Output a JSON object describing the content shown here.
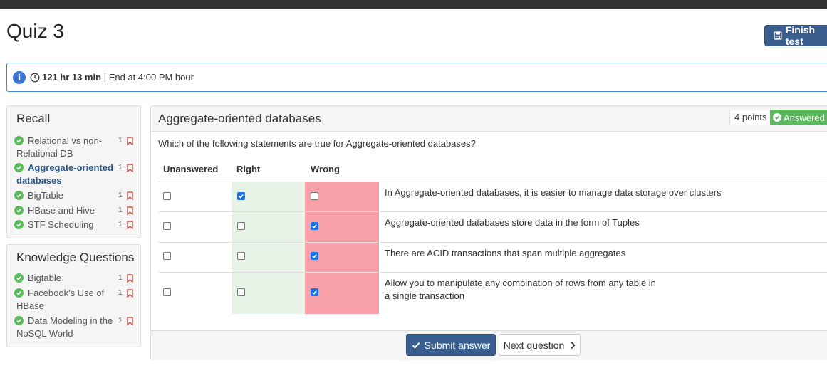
{
  "page": {
    "title": "Quiz 3"
  },
  "header": {
    "finish_label": "Finish test"
  },
  "timer": {
    "remaining": "121 hr 13 min",
    "end_text": " | End at 4:00 PM hour"
  },
  "sidebar": {
    "recall": {
      "title": "Recall",
      "items": [
        {
          "label": "Relational vs non-Relational DB",
          "count": "1",
          "active": false
        },
        {
          "label": "Aggregate-oriented databases",
          "count": "1",
          "active": true
        },
        {
          "label": "BigTable",
          "count": "1",
          "active": false
        },
        {
          "label": "HBase and Hive",
          "count": "1",
          "active": false
        },
        {
          "label": "STF Scheduling",
          "count": "1",
          "active": false
        }
      ]
    },
    "knowledge": {
      "title": "Knowledge Questions",
      "items": [
        {
          "label": "Bigtable",
          "count": "1"
        },
        {
          "label": "Facebook's Use of HBase",
          "count": "1"
        },
        {
          "label": "Data Modeling in the NoSQL World",
          "count": "1"
        }
      ]
    }
  },
  "question": {
    "title": "Aggregate-oriented databases",
    "points": "4 points",
    "status": "Answered",
    "prompt": "Which of the following statements are true for Aggregate-oriented databases?",
    "columns": {
      "unanswered": "Unanswered",
      "right": "Right",
      "wrong": "Wrong"
    },
    "statements": [
      {
        "text": "In Aggregate-oriented databases, it is easier to manage data storage over clusters",
        "answer": "right"
      },
      {
        "text": "Aggregate-oriented databases store data in the form of Tuples",
        "answer": "wrong"
      },
      {
        "text": "There are ACID transactions that span multiple aggregates",
        "answer": "wrong"
      },
      {
        "text": "Allow you to manipulate any combination of rows from any table in a single transaction",
        "answer": "wrong"
      }
    ],
    "submit_label": "Submit answer",
    "next_label": "Next question"
  },
  "colors": {
    "accent": "#3a5f8f",
    "success": "#5cb85c",
    "right_bg": "#e8f4e8",
    "wrong_bg": "#f8a1a8",
    "info": "#3a76d6"
  }
}
